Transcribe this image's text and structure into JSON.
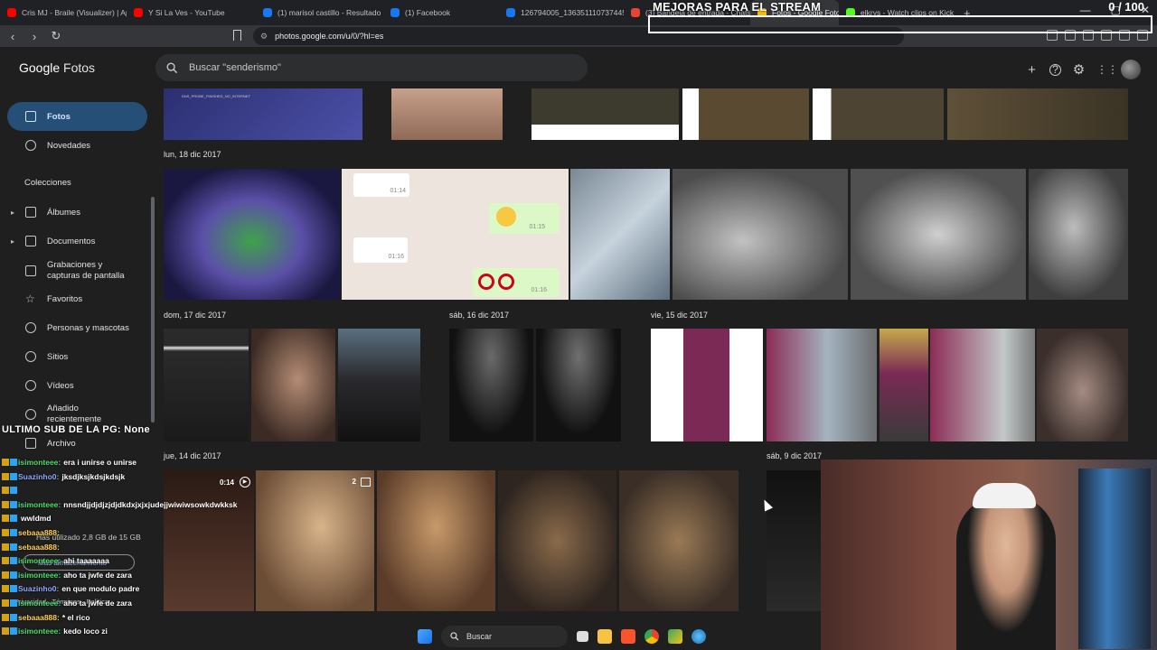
{
  "browser": {
    "tabs": [
      {
        "label": "Cris MJ - Braile (Visualizer) | Ap",
        "color": "#ff0000"
      },
      {
        "label": "Y Si La Ves - YouTube",
        "color": "#ff0000"
      },
      {
        "label": "(1) marisol castillo - Resultado",
        "color": "#1877f2"
      },
      {
        "label": "(1) Facebook",
        "color": "#1877f2"
      },
      {
        "label": "126794005_136351110737445",
        "color": "#1877f2"
      },
      {
        "label": "(3) Bandeja de entrada - Chats",
        "color": "#ea4335"
      },
      {
        "label": "Fotos - Google Fotos",
        "color": "#fbbc04"
      },
      {
        "label": "elkrys - Watch clips on Kick",
        "color": "#53fc18"
      }
    ],
    "new_tab": "+",
    "url": "photos.google.com/u/0/?hl=es",
    "window_controls": [
      "—",
      "▢",
      "✕"
    ]
  },
  "stream": {
    "title": "MEJORAS PARA EL STREAM",
    "counter": "0 / 100"
  },
  "app": {
    "logo_google": "Google",
    "logo_product": "Fotos",
    "search_placeholder": "Buscar \"senderismo\""
  },
  "sidebar": {
    "primary": [
      {
        "label": "Fotos",
        "icon": "photo-icon",
        "active": true
      },
      {
        "label": "Novedades",
        "icon": "bell-icon",
        "active": false
      }
    ],
    "collections_title": "Colecciones",
    "collections": [
      {
        "label": "Álbumes",
        "icon": "album-icon",
        "caret": "▸"
      },
      {
        "label": "Documentos",
        "icon": "document-icon",
        "caret": "▸"
      },
      {
        "label": "Grabaciones y capturas de pantalla",
        "icon": "screenshot-icon"
      },
      {
        "label": "Favoritos",
        "icon": "star-icon"
      },
      {
        "label": "Personas y mascotas",
        "icon": "face-icon"
      },
      {
        "label": "Sitios",
        "icon": "location-pin-icon"
      },
      {
        "label": "Vídeos",
        "icon": "video-icon"
      },
      {
        "label": "Añadido recientemente",
        "icon": "clock-icon"
      },
      {
        "label": "Archivo",
        "icon": "archive-icon"
      }
    ],
    "storage_text": "Has utilizado 2,8 GB de 15 GB",
    "storage_button": "Más almacenamiento",
    "footer": "Privacidad  ·  Términos  ·  Política"
  },
  "grid": {
    "dates": [
      "lun, 18 dic 2017",
      "dom, 17 dic 2017",
      "sáb, 16 dic 2017",
      "vie, 15 dic 2017",
      "jue, 14 dic 2017",
      "sáb, 9 dic 2017"
    ],
    "video_duration": "0:14",
    "burst_count": "2",
    "chat_times": [
      "01:14",
      "01:15",
      "01:16",
      "01:16"
    ],
    "screen_text": "DNS_PROBE_FINISHED_NO_INTERNET"
  },
  "chat": {
    "title": "ULTIMO SUB DE LA PG: None",
    "messages": [
      {
        "user": "isimonteee:",
        "text": "era i unirse o unirse",
        "cls": "u1"
      },
      {
        "user": "Suazinho0:",
        "text": "jksdjksjkdsjkdsjk",
        "cls": "u2"
      },
      {
        "user": "",
        "text": "",
        "cls": "u1"
      },
      {
        "user": "isimonteee:",
        "text": "nnsndjjdjdjzjdjdkdxjxjxjudejjwiwiwsowkdwkksk",
        "cls": "u1"
      },
      {
        "user": "",
        "text": "wwldmd",
        "cls": "u1"
      },
      {
        "user": "sebaaa888:",
        "text": "",
        "cls": "u3"
      },
      {
        "user": "sebaaa888:",
        "text": "",
        "cls": "u3"
      },
      {
        "user": "isimonteee:",
        "text": "ahi taaaaaaa",
        "cls": "u1"
      },
      {
        "user": "isimonteee:",
        "text": "aho ta jwfe de zara",
        "cls": "u1"
      },
      {
        "user": "Suazinho0:",
        "text": "en que modulo padre",
        "cls": "u2"
      },
      {
        "user": "isimonteee:",
        "text": "aho ta jwfe de zara",
        "cls": "u1"
      },
      {
        "user": "sebaaa888:",
        "text": "* el rico",
        "cls": "u3"
      },
      {
        "user": "isimonteee:",
        "text": "kedo loco zi",
        "cls": "u1"
      }
    ]
  },
  "taskbar": {
    "search_label": "Buscar"
  }
}
